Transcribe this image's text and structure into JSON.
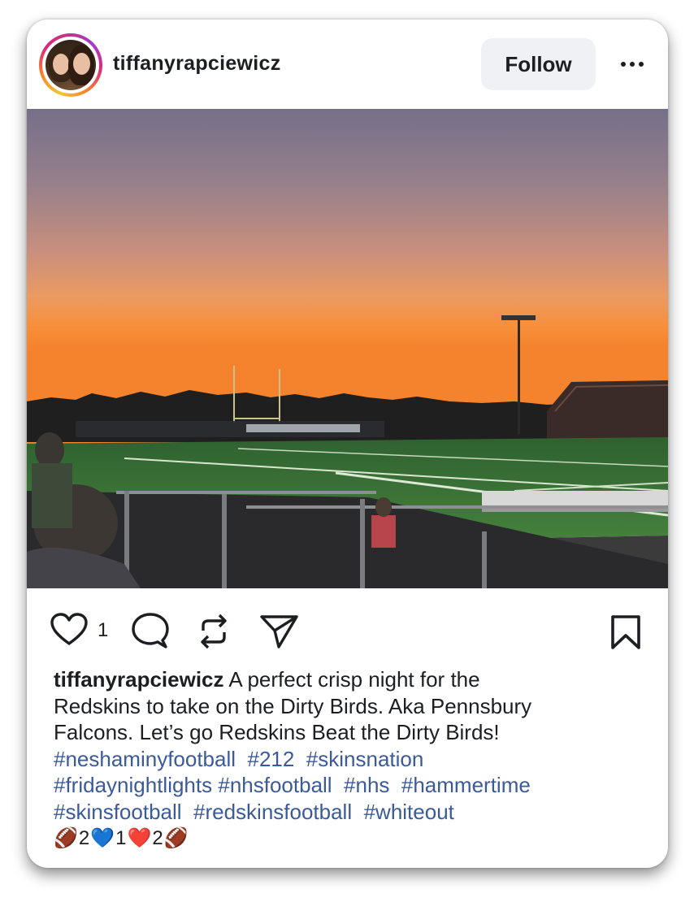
{
  "post": {
    "username": "tiffanyrapciewicz",
    "follow_label": "Follow",
    "like_count": "1",
    "caption_user": "tiffanyrapciewicz",
    "caption_text": [
      "A perfect crisp night for the",
      "Redskins to take on the Dirty Birds.  Aka Pennsbury",
      "Falcons.  Let’s go Redskins Beat the Dirty Birds!"
    ],
    "hashtag_lines": [
      [
        "#neshaminyfootball",
        "#212",
        "#skinsnation"
      ],
      [
        "#fridaynightlights",
        "#nhsfootball",
        "#nhs",
        "#hammertime"
      ],
      [
        "#skinsfootball",
        "#redskinsfootball",
        "#whiteout"
      ]
    ],
    "emoji_line": [
      "🏈",
      "2",
      "💙",
      "1",
      "❤️",
      "2",
      "🏈"
    ]
  },
  "icons": {
    "like": "heart-icon",
    "comment": "comment-icon",
    "repost": "repost-icon",
    "share": "send-icon",
    "save": "bookmark-icon",
    "more": "more-dots-icon"
  },
  "colors": {
    "text": "#1c1e21",
    "hashtag": "#3b5a99",
    "follow_bg": "#eff1f4",
    "sky_top": "#7a7182",
    "sky_horizon": "#f8923c",
    "field": "#3f7a37"
  }
}
